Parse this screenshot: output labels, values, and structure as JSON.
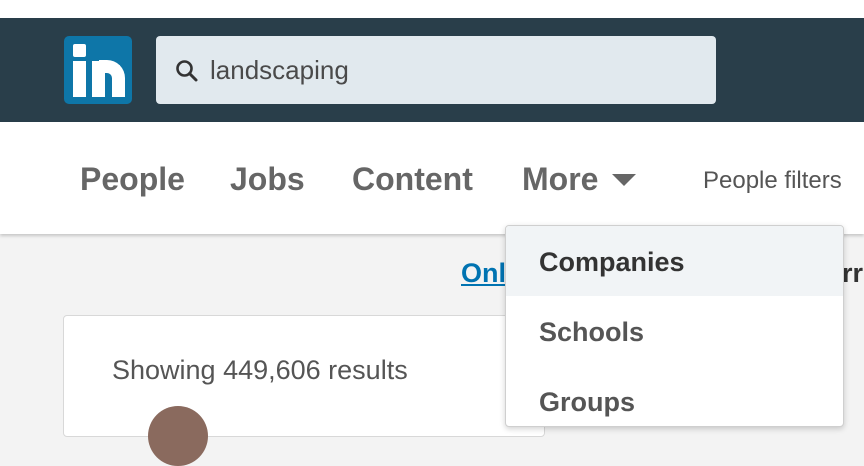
{
  "search": {
    "value": "landscaping"
  },
  "nav": {
    "people": "People",
    "jobs": "Jobs",
    "content": "Content",
    "more": "More",
    "filters": "People filters"
  },
  "banner": {
    "link_text": "Onl",
    "tail_text": "rr"
  },
  "results": {
    "count_text": "Showing 449,606 results"
  },
  "more_menu": {
    "items": [
      "Companies",
      "Schools",
      "Groups"
    ]
  },
  "colors": {
    "header": "#293e4a",
    "brand": "#0e76a8",
    "link": "#0073b1"
  },
  "icons": [
    "linkedin-logo-icon",
    "search-icon",
    "caret-down-icon"
  ]
}
